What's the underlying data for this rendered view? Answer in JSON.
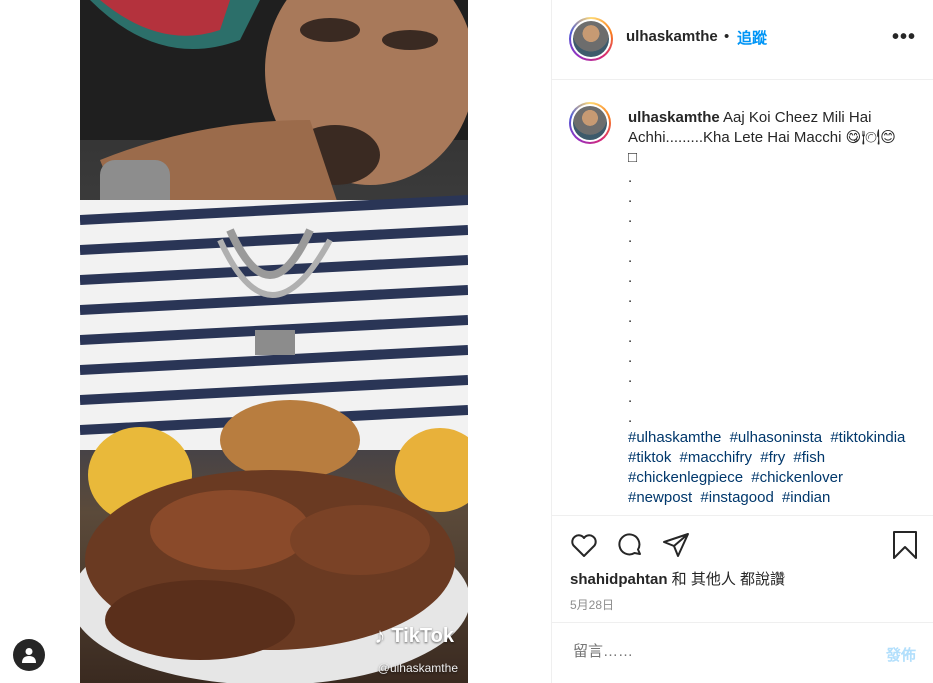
{
  "video": {
    "watermark_brand": "TikTok",
    "watermark_handle": "@ulhaskamthe"
  },
  "header": {
    "username": "ulhaskamthe",
    "separator": "•",
    "follow_label": "追蹤",
    "more_label": "•••"
  },
  "caption": {
    "username": "ulhaskamthe",
    "text_line1": "Aaj Koi Cheez Mili Hai Achhi.........Kha Lete Hai Macchi 😋🍽😊",
    "text_line2": "□",
    "dots": [
      ".",
      ".",
      ".",
      ".",
      ".",
      ".",
      ".",
      ".",
      ".",
      ".",
      ".",
      ".",
      "."
    ],
    "hashtags": [
      "#ulhaskamthe",
      "#ulhasoninsta",
      "#tiktokindia",
      "#tiktok",
      "#macchifry",
      "#fry",
      "#fish",
      "#chickenlegpiece",
      "#chickenlover",
      "#newpost",
      "#instagood",
      "#indian"
    ]
  },
  "actions": {
    "liked_by_user": "shahidpahtan",
    "liked_by_suffix": " 和 其他人 都說讚",
    "date": "5月28日"
  },
  "comment": {
    "placeholder": "留言……",
    "post_label": "發佈"
  },
  "icons": [
    "user-icon",
    "heart-icon",
    "comment-icon",
    "share-icon",
    "bookmark-icon",
    "more-icon",
    "tiktok-icon"
  ],
  "colors": {
    "link_blue": "#0095f6",
    "hashtag_blue": "#00376b",
    "muted_gray": "#8e8e8e",
    "post_disabled": "#b2dffc"
  }
}
